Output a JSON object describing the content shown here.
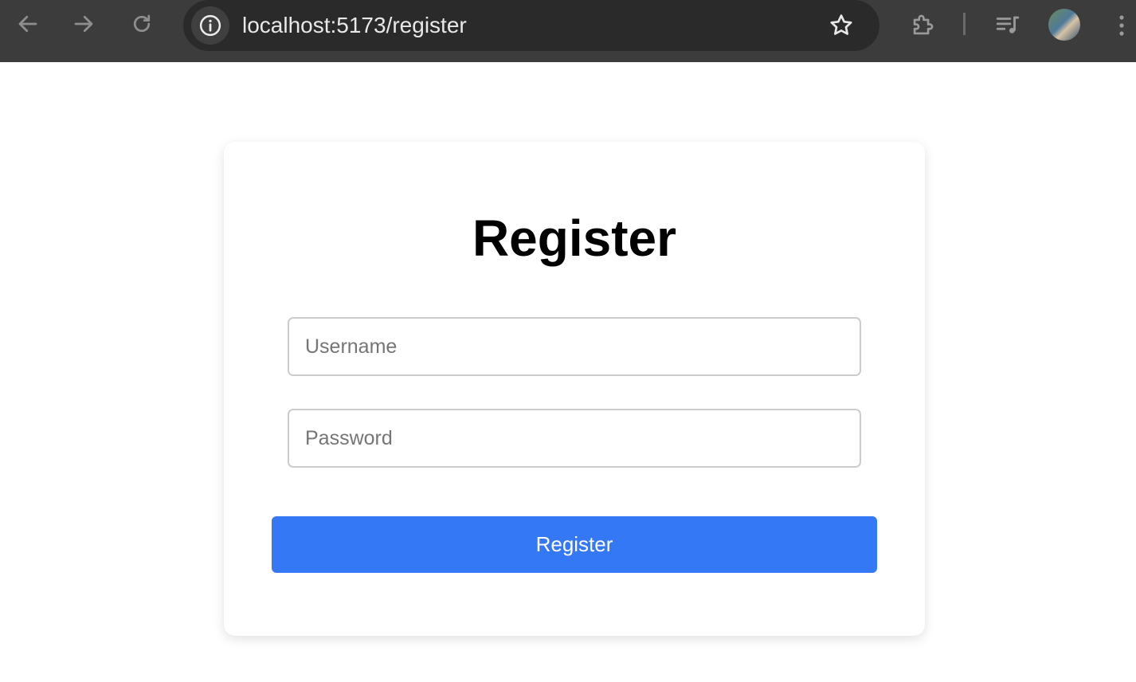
{
  "browser": {
    "url": "localhost:5173/register",
    "icons": {
      "back": "arrow-left-icon",
      "forward": "arrow-right-icon",
      "reload": "reload-icon",
      "site_info": "info-icon",
      "bookmark": "star-icon",
      "extensions": "puzzle-icon",
      "media": "media-queue-icon",
      "profile": "avatar",
      "menu": "kebab-menu-icon"
    }
  },
  "form": {
    "title": "Register",
    "username_placeholder": "Username",
    "username_value": "",
    "password_placeholder": "Password",
    "password_value": "",
    "submit_label": "Register"
  },
  "colors": {
    "toolbar_bg": "#3c3c3c",
    "omnibox_bg": "#2a2a2a",
    "button_primary": "#3478f6",
    "input_border": "#cccccc"
  }
}
